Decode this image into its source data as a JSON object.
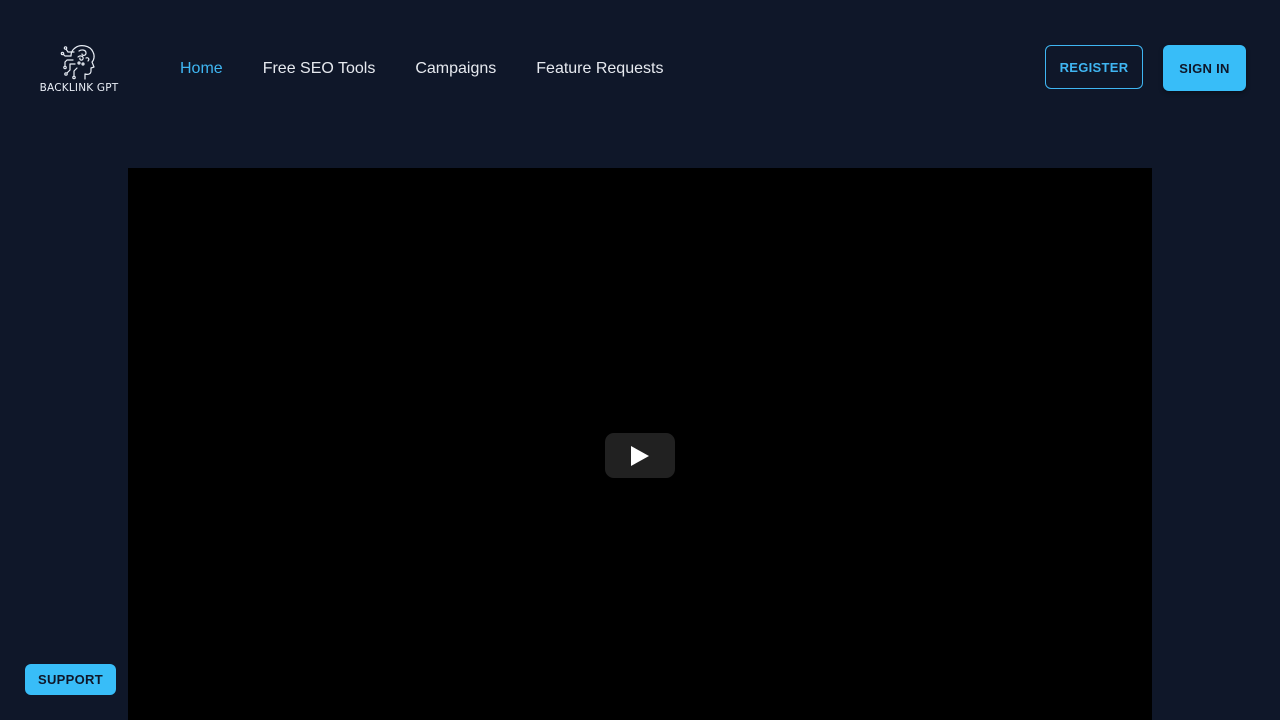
{
  "logo": {
    "text": "BACKLINK GPT"
  },
  "nav": {
    "items": [
      {
        "label": "Home",
        "active": true
      },
      {
        "label": "Free SEO Tools",
        "active": false
      },
      {
        "label": "Campaigns",
        "active": false
      },
      {
        "label": "Feature Requests",
        "active": false
      }
    ]
  },
  "header": {
    "register_label": "REGISTER",
    "signin_label": "SIGN IN"
  },
  "video": {
    "play_icon": "play-icon"
  },
  "support": {
    "label": "SUPPORT"
  },
  "colors": {
    "background": "#0f1729",
    "accent": "#38bdf8",
    "active_link": "#3fb6f2",
    "nav_text": "#e6e9ef",
    "video_bg": "#000000"
  }
}
